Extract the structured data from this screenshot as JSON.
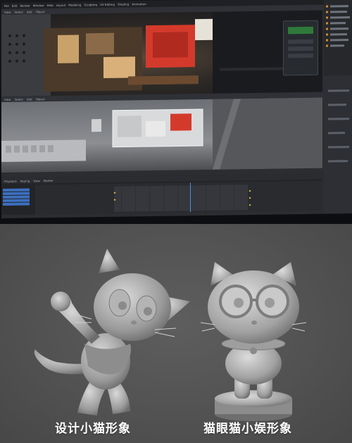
{
  "editor": {
    "menu": [
      "File",
      "Edit",
      "Render",
      "Window",
      "Help",
      "Layout",
      "Modeling",
      "Sculpting",
      "UV Editing",
      "Shading",
      "Animation"
    ],
    "viewport_header": [
      "View",
      "Select",
      "Add",
      "Object"
    ],
    "timeline_header": [
      "Playback",
      "Keying",
      "View",
      "Marker"
    ]
  },
  "captions": {
    "left": "设计小猫形象",
    "right": "猫眼猫小娱形象"
  },
  "colors": {
    "accent_blue": "#3c6fbf",
    "keyframe": "#e8c34a",
    "set_red": "#d43a2c"
  }
}
